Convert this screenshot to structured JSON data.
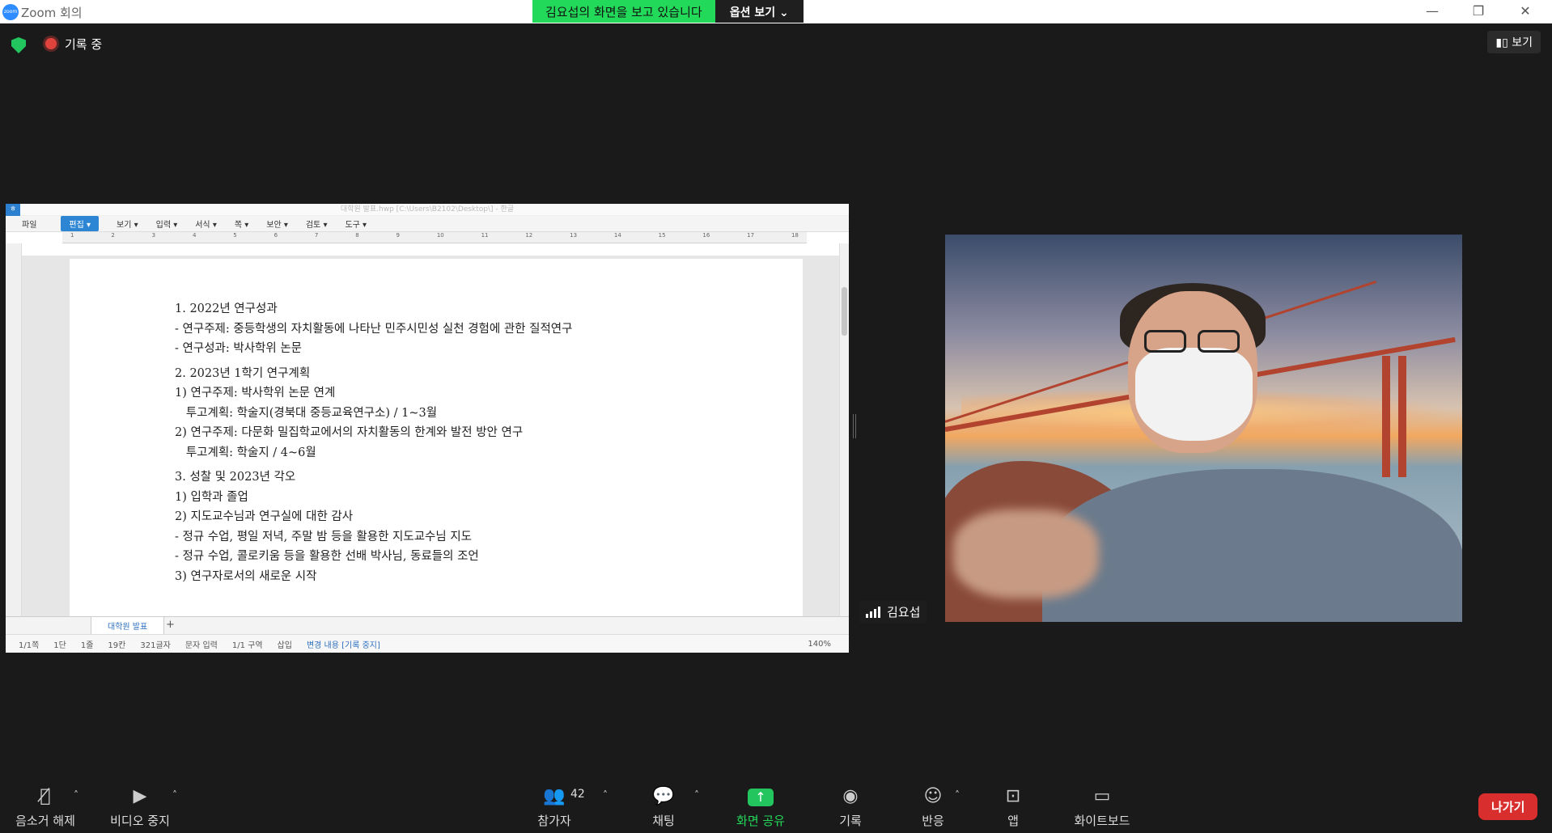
{
  "window": {
    "app_title": "Zoom 회의",
    "logo_text": "zoom",
    "share_banner": "김요섭의 화면을 보고 있습니다",
    "options_label": "옵션 보기 ⌄",
    "min_icon": "—",
    "restore_icon": "❐",
    "close_icon": "✕"
  },
  "topbar": {
    "recording_label": "기록 중",
    "view_label": "▮▯ 보기"
  },
  "shared_app": {
    "title": "대학원 발표.hwp [C:\\Users\\B2102\\Desktop\\] - 한글",
    "logo": "ㅎ",
    "menu": [
      "파일",
      "편집 ▾",
      "보기 ▾",
      "입력 ▾",
      "서식 ▾",
      "쪽 ▾",
      "보안 ▾",
      "검토 ▾",
      "도구 ▾"
    ],
    "ruler": [
      "1",
      "2",
      "3",
      "4",
      "5",
      "6",
      "7",
      "8",
      "9",
      "10",
      "11",
      "12",
      "13",
      "14",
      "15",
      "16",
      "17",
      "18"
    ],
    "document_lines": [
      "1. 2022년 연구성과",
      "- 연구주제: 중등학생의 자치활동에 나타난 민주시민성 실천 경험에 관한 질적연구",
      "- 연구성과: 박사학위 논문",
      "2. 2023년 1학기 연구계획",
      "1) 연구주제: 박사학위 논문 연계",
      "   투고계획: 학술지(경북대 중등교육연구소) / 1~3월",
      "2) 연구주제: 다문화 밀집학교에서의 자치활동의 한계와 발전 방안 연구",
      "   투고계획: 학술지 / 4~6월",
      "3. 성찰 및 2023년 각오",
      "1) 입학과 졸업",
      "2) 지도교수님과 연구실에 대한 감사",
      "- 정규 수업, 평일 저녁, 주말 밤 등을 활용한 지도교수님 지도",
      "- 정규 수업, 콜로키움 등을 활용한 선배 박사님, 동료들의 조언",
      "3) 연구자로서의 새로운 시작"
    ],
    "tab_name": "대학원 발표",
    "add_tab": "+",
    "status": [
      "1/1쪽",
      "1단",
      "1줄",
      "19칸",
      "321글자",
      "문자 입력",
      "1/1 구역",
      "삽입",
      "변경 내용 [기록 중지]"
    ],
    "zoom": "140%"
  },
  "video": {
    "participant_name": "김요섭"
  },
  "toolbar": {
    "mute_label": "음소거 해제",
    "video_label": "비디오 중지",
    "participants_label": "참가자",
    "participants_count": "42",
    "chat_label": "채팅",
    "share_label": "화면 공유",
    "record_label": "기록",
    "reactions_label": "반응",
    "apps_label": "앱",
    "whiteboard_label": "화이트보드",
    "leave_label": "나가기"
  },
  "colors": {
    "share_green": "#23d959",
    "leave_red": "#d92e2e",
    "background": "#1a1a1a"
  }
}
